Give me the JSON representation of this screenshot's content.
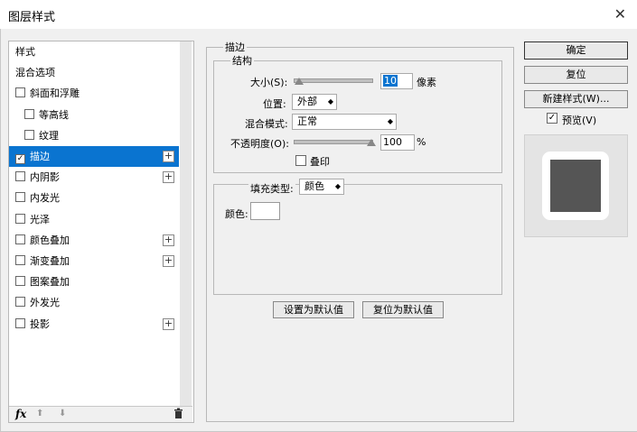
{
  "window": {
    "title": "图层样式",
    "close_glyph": "✕"
  },
  "sidebar": {
    "items": [
      {
        "label": "样式",
        "checkbox": false,
        "checked": false,
        "plus": false,
        "selected": false
      },
      {
        "label": "混合选项",
        "checkbox": false,
        "checked": false,
        "plus": false,
        "selected": false
      },
      {
        "label": "斜面和浮雕",
        "checkbox": true,
        "checked": false,
        "plus": false,
        "selected": false
      },
      {
        "label": "等高线",
        "checkbox": true,
        "checked": false,
        "plus": false,
        "selected": false,
        "indent": true
      },
      {
        "label": "纹理",
        "checkbox": true,
        "checked": false,
        "plus": false,
        "selected": false,
        "indent": true
      },
      {
        "label": "描边",
        "checkbox": true,
        "checked": true,
        "plus": true,
        "selected": true
      },
      {
        "label": "内阴影",
        "checkbox": true,
        "checked": false,
        "plus": true,
        "selected": false
      },
      {
        "label": "内发光",
        "checkbox": true,
        "checked": false,
        "plus": false,
        "selected": false
      },
      {
        "label": "光泽",
        "checkbox": true,
        "checked": false,
        "plus": false,
        "selected": false
      },
      {
        "label": "颜色叠加",
        "checkbox": true,
        "checked": false,
        "plus": true,
        "selected": false
      },
      {
        "label": "渐变叠加",
        "checkbox": true,
        "checked": false,
        "plus": true,
        "selected": false
      },
      {
        "label": "图案叠加",
        "checkbox": true,
        "checked": false,
        "plus": false,
        "selected": false
      },
      {
        "label": "外发光",
        "checkbox": true,
        "checked": false,
        "plus": false,
        "selected": false
      },
      {
        "label": "投影",
        "checkbox": true,
        "checked": false,
        "plus": true,
        "selected": false
      }
    ],
    "footer": {
      "fx": "fx",
      "up": "⬆",
      "down": "⬇",
      "trash": "🗑"
    }
  },
  "stroke": {
    "section_title": "描边",
    "structure_title": "结构",
    "size_label": "大小(S):",
    "size_value": "10",
    "size_unit": "像素",
    "position_label": "位置:",
    "position_value": "外部",
    "blend_label": "混合模式:",
    "blend_value": "正常",
    "opacity_label": "不透明度(O):",
    "opacity_value": "100",
    "opacity_unit": "%",
    "overprint_label": "叠印",
    "fill_type_label": "填充类型:",
    "fill_type_value": "颜色",
    "color_label": "颜色:",
    "color_value": "#ffffff",
    "set_default": "设置为默认值",
    "reset_default": "复位为默认值"
  },
  "actions": {
    "ok": "确定",
    "reset": "复位",
    "new_style": "新建样式(W)...",
    "preview_label": "预览(V)",
    "preview_checked": true
  },
  "preview": {
    "swatch_color": "#555555",
    "border_color": "#ffffff"
  },
  "colors": {
    "selection": "#0a74d0"
  }
}
